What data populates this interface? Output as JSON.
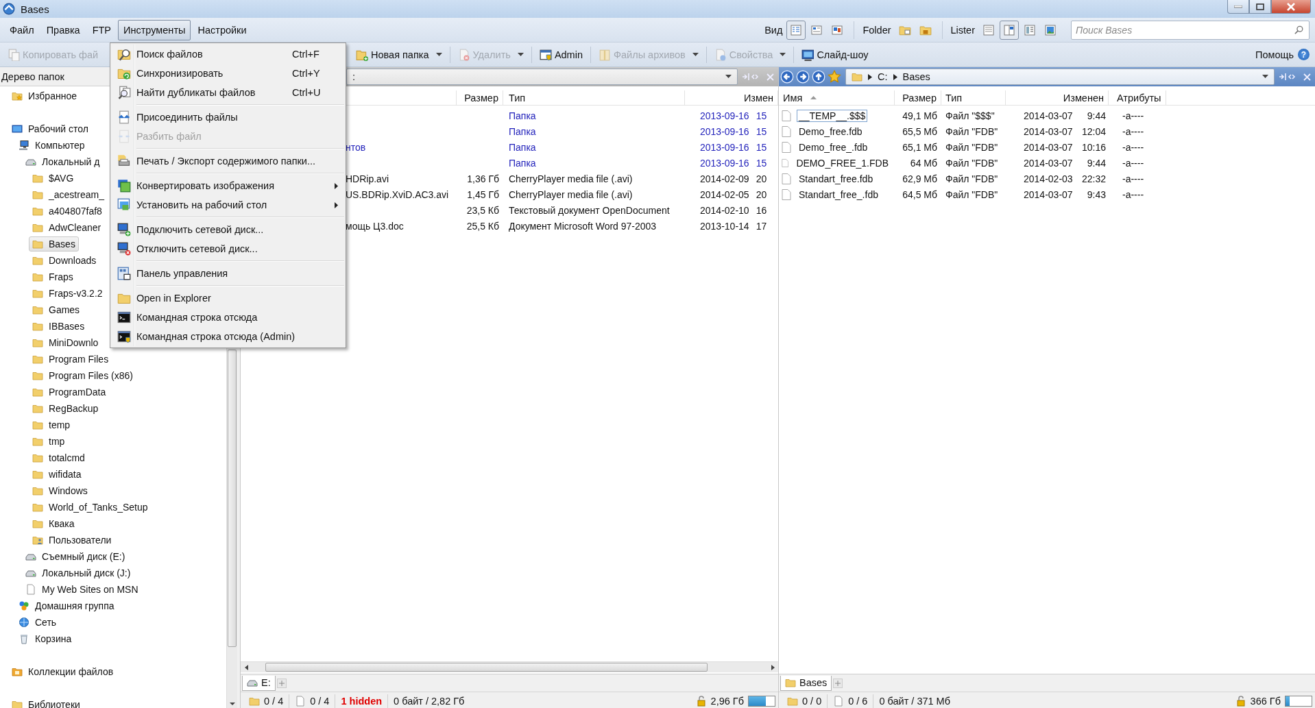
{
  "window": {
    "title": "Bases"
  },
  "menu_bar": [
    {
      "label": "Файл",
      "selected": false
    },
    {
      "label": "Правка",
      "selected": false
    },
    {
      "label": "FTP",
      "selected": false
    },
    {
      "label": "Инструменты",
      "selected": true
    },
    {
      "label": "Настройки",
      "selected": false
    }
  ],
  "view_bar": {
    "view_label": "Вид",
    "view_buttons": [
      {
        "selected": true
      },
      {
        "selected": false
      },
      {
        "selected": false
      }
    ],
    "folder_label": "Folder",
    "lister_label": "Lister",
    "lister_buttons": [
      {
        "selected": false
      },
      {
        "selected": true
      },
      {
        "selected": false
      },
      {
        "selected": false
      }
    ]
  },
  "search": {
    "placeholder": "Поиск Bases"
  },
  "toolbar": {
    "items": [
      {
        "label": "Копировать фай",
        "kind": "copy",
        "disabled": true,
        "dropdown": false
      },
      {
        "label": "Новая папка",
        "kind": "new-folder",
        "disabled": false,
        "dropdown": true
      },
      {
        "label": "Удалить",
        "kind": "delete",
        "disabled": true,
        "dropdown": true
      },
      {
        "label": "Admin",
        "kind": "admin",
        "disabled": false,
        "dropdown": false
      },
      {
        "label": "Файлы архивов",
        "kind": "archive",
        "disabled": true,
        "dropdown": true
      },
      {
        "label": "Свойства",
        "kind": "properties",
        "disabled": true,
        "dropdown": true
      },
      {
        "label": "Слайд-шоу",
        "kind": "slideshow",
        "disabled": false,
        "dropdown": false
      }
    ],
    "help": {
      "label": "Помощь",
      "glyph": "?"
    }
  },
  "tree": {
    "header": "Дерево папок",
    "items": [
      {
        "label": "Избранное",
        "kind": "favorites",
        "selected": false
      },
      {
        "label": "Рабочий стол",
        "kind": "desktop",
        "selected": false,
        "children": [
          {
            "label": "Компьютер",
            "kind": "computer",
            "selected": false,
            "children": [
              {
                "label": "Локальный д",
                "kind": "drive",
                "selected": false,
                "children": [
                  {
                    "label": "$AVG",
                    "kind": "folder",
                    "selected": false
                  },
                  {
                    "label": "_acestream_",
                    "kind": "folder",
                    "selected": false
                  },
                  {
                    "label": "a404807faf8",
                    "kind": "folder",
                    "selected": false
                  },
                  {
                    "label": "AdwCleaner",
                    "kind": "folder",
                    "selected": false
                  },
                  {
                    "label": "Bases",
                    "kind": "folder",
                    "selected": true
                  },
                  {
                    "label": "Downloads",
                    "kind": "folder",
                    "selected": false
                  },
                  {
                    "label": "Fraps",
                    "kind": "folder",
                    "selected": false
                  },
                  {
                    "label": "Fraps-v3.2.2",
                    "kind": "folder",
                    "selected": false
                  },
                  {
                    "label": "Games",
                    "kind": "folder",
                    "selected": false
                  },
                  {
                    "label": "IBBases",
                    "kind": "folder",
                    "selected": false
                  },
                  {
                    "label": "MiniDownlo",
                    "kind": "folder",
                    "selected": false
                  },
                  {
                    "label": "Program Files",
                    "kind": "folder",
                    "selected": false
                  },
                  {
                    "label": "Program Files (x86)",
                    "kind": "folder",
                    "selected": false
                  },
                  {
                    "label": "ProgramData",
                    "kind": "folder",
                    "selected": false
                  },
                  {
                    "label": "RegBackup",
                    "kind": "folder",
                    "selected": false
                  },
                  {
                    "label": "temp",
                    "kind": "folder",
                    "selected": false
                  },
                  {
                    "label": "tmp",
                    "kind": "folder",
                    "selected": false
                  },
                  {
                    "label": "totalcmd",
                    "kind": "folder",
                    "selected": false
                  },
                  {
                    "label": "wifidata",
                    "kind": "folder",
                    "selected": false
                  },
                  {
                    "label": "Windows",
                    "kind": "folder",
                    "selected": false
                  },
                  {
                    "label": "World_of_Tanks_Setup",
                    "kind": "folder",
                    "selected": false
                  },
                  {
                    "label": "Квака",
                    "kind": "folder",
                    "selected": false
                  },
                  {
                    "label": "Пользователи",
                    "kind": "users",
                    "selected": false
                  }
                ]
              },
              {
                "label": "Съемный диск (E:)",
                "kind": "drive",
                "selected": false
              },
              {
                "label": "Локальный диск (J:)",
                "kind": "drive",
                "selected": false
              },
              {
                "label": "My Web Sites on MSN",
                "kind": "page",
                "selected": false
              }
            ]
          },
          {
            "label": "Домашняя группа",
            "kind": "homegroup",
            "selected": false
          },
          {
            "label": "Сеть",
            "kind": "network",
            "selected": false
          },
          {
            "label": "Корзина",
            "kind": "trash",
            "selected": false
          }
        ]
      },
      {
        "label": "Коллекции файлов",
        "kind": "collections",
        "selected": false
      },
      {
        "label": "Библиотеки",
        "kind": "folder",
        "selected": false
      }
    ]
  },
  "left_pane": {
    "active": false,
    "path": [
      ":"
    ],
    "columns": [
      {
        "label": "Размер",
        "sorted": false
      },
      {
        "label": "Тип",
        "sorted": false
      },
      {
        "label": "Измен",
        "sorted": false
      }
    ],
    "rows": [
      {
        "kind": "folder",
        "type": "Папка",
        "date": "2013-09-16",
        "time": "15"
      },
      {
        "kind": "folder",
        "type": "Папка",
        "date": "2013-09-16",
        "time": "15"
      },
      {
        "kind": "folder",
        "name": "нтов",
        "type": "Папка",
        "date": "2013-09-16",
        "time": "15"
      },
      {
        "kind": "folder",
        "type": "Папка",
        "date": "2013-09-16",
        "time": "15"
      },
      {
        "kind": "file",
        "name": "HDRip.avi",
        "size": "1,36 Гб",
        "type": "CherryPlayer media file (.avi)",
        "date": "2014-02-09",
        "time": "20"
      },
      {
        "kind": "file",
        "name": "US.BDRip.XviD.AC3.avi",
        "size": "1,45 Гб",
        "type": "CherryPlayer media file (.avi)",
        "date": "2014-02-05",
        "time": "20"
      },
      {
        "kind": "file",
        "size": "23,5 Кб",
        "type": "Текстовый документ OpenDocument",
        "date": "2014-02-10",
        "time": "16"
      },
      {
        "kind": "file",
        "name": "мощь Ц3.doc",
        "size": "25,5 Кб",
        "type": "Документ Microsoft Word 97-2003",
        "date": "2013-10-14",
        "time": "17"
      }
    ],
    "tab": "E:",
    "status": {
      "folders": "0 / 4",
      "files": "0 / 4",
      "hidden": "1 hidden",
      "selection": "0 байт / 2,82 Гб",
      "free": "2,96 Гб",
      "level": 0.65
    }
  },
  "right_pane": {
    "active": true,
    "path": [
      "C:",
      "Bases"
    ],
    "columns": [
      {
        "label": "Имя",
        "sorted": true
      },
      {
        "label": "Размер",
        "sorted": false
      },
      {
        "label": "Тип",
        "sorted": false
      },
      {
        "label": "Изменен",
        "sorted": false
      },
      {
        "label": "Атрибуты",
        "sorted": false
      }
    ],
    "rows": [
      {
        "kind": "file",
        "name": "__TEMP__.$$$",
        "size": "49,1 Мб",
        "type": "Файл \"$$$\"",
        "date": "2014-03-07",
        "time": "9:44",
        "attributes": "-a----",
        "focused": true
      },
      {
        "kind": "file",
        "name": "Demo_free.fdb",
        "size": "65,5 Мб",
        "type": "Файл \"FDB\"",
        "date": "2014-03-07",
        "time": "12:04",
        "attributes": "-a----",
        "focused": false
      },
      {
        "kind": "file",
        "name": "Demo_free_.fdb",
        "size": "65,1 Мб",
        "type": "Файл \"FDB\"",
        "date": "2014-03-07",
        "time": "10:16",
        "attributes": "-a----",
        "focused": false
      },
      {
        "kind": "file",
        "name": "DEMO_FREE_1.FDB",
        "size": "64 Мб",
        "type": "Файл \"FDB\"",
        "date": "2014-03-07",
        "time": "9:44",
        "attributes": "-a----",
        "focused": false
      },
      {
        "kind": "file",
        "name": "Standart_free.fdb",
        "size": "62,9 Мб",
        "type": "Файл \"FDB\"",
        "date": "2014-02-03",
        "time": "22:32",
        "attributes": "-a----",
        "focused": false
      },
      {
        "kind": "file",
        "name": "Standart_free_.fdb",
        "size": "64,5 Мб",
        "type": "Файл \"FDB\"",
        "date": "2014-03-07",
        "time": "9:43",
        "attributes": "-a----",
        "focused": false
      }
    ],
    "tab": "Bases",
    "status": {
      "folders": "0 / 0",
      "files": "0 / 6",
      "selection": "0 байт / 371 Мб",
      "free": "366 Гб",
      "level": 0.15
    }
  },
  "tools_menu": {
    "groups": [
      [
        {
          "label": "Поиск файлов",
          "shortcut": "Ctrl+F",
          "kind": "search",
          "disabled": false,
          "submenu": false
        },
        {
          "label": "Синхронизировать",
          "shortcut": "Ctrl+Y",
          "kind": "sync",
          "disabled": false,
          "submenu": false
        },
        {
          "label": "Найти дубликаты файлов",
          "shortcut": "Ctrl+U",
          "kind": "duplicates",
          "disabled": false,
          "submenu": false
        }
      ],
      [
        {
          "label": "Присоединить файлы",
          "kind": "join",
          "disabled": false,
          "submenu": false
        },
        {
          "label": "Разбить файл",
          "kind": "split",
          "disabled": true,
          "submenu": false
        }
      ],
      [
        {
          "label": "Печать / Экспорт содержимого папки...",
          "kind": "print",
          "disabled": false,
          "submenu": false
        }
      ],
      [
        {
          "label": "Конвертировать изображения",
          "kind": "picture",
          "disabled": false,
          "submenu": true
        },
        {
          "label": "Установить на рабочий стол",
          "kind": "wallpaper",
          "disabled": false,
          "submenu": true
        }
      ],
      [
        {
          "label": "Подключить сетевой диск...",
          "kind": "map-drive",
          "disabled": false,
          "submenu": false
        },
        {
          "label": "Отключить сетевой диск...",
          "kind": "unmap-drive",
          "disabled": false,
          "submenu": false
        }
      ],
      [
        {
          "label": "Панель управления",
          "kind": "control-panel",
          "disabled": false,
          "submenu": false
        }
      ],
      [
        {
          "label": "Open in Explorer",
          "kind": "explorer",
          "disabled": false,
          "submenu": false
        },
        {
          "label": "Командная строка отсюда",
          "kind": "cmd",
          "disabled": false,
          "submenu": false
        },
        {
          "label": "Командная строка отсюда (Admin)",
          "kind": "cmd-admin",
          "disabled": false,
          "submenu": false
        }
      ]
    ]
  }
}
